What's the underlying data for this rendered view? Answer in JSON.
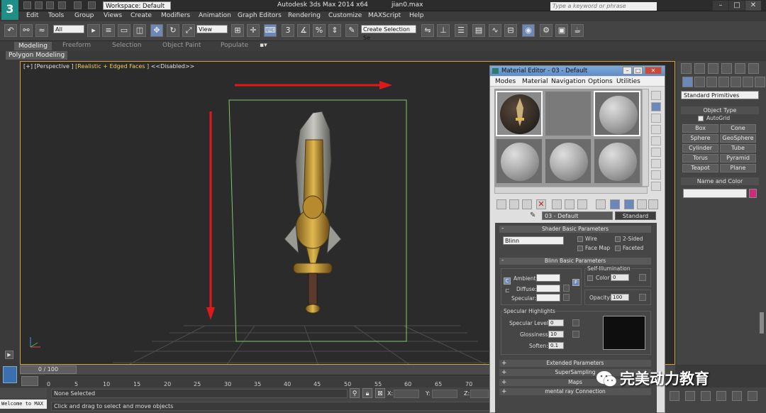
{
  "app": {
    "workspace_label": "Workspace: Default",
    "title": "Autodesk 3ds Max  2014 x64",
    "filename": "jian0.max",
    "search_placeholder": "Type a keyword or phrase"
  },
  "menu": [
    "Edit",
    "Tools",
    "Group",
    "Views",
    "Create",
    "Modifiers",
    "Animation",
    "Graph Editors",
    "Rendering",
    "Customize",
    "MAXScript",
    "Help"
  ],
  "toolbar": {
    "filter_select": "All",
    "ref_coord_select": "View",
    "selection_set_placeholder": "Create Selection Se",
    "icon_names": [
      "undo-icon",
      "redo-icon",
      "link-icon",
      "unlink-icon",
      "bind-space-warp-icon",
      "select-icon",
      "select-by-name-icon",
      "rect-region-icon",
      "window-crossing-icon",
      "move-icon",
      "rotate-icon",
      "scale-icon",
      "pivot-icon",
      "snap-3-icon",
      "angle-snap-icon",
      "percent-snap-icon",
      "spinner-snap-icon",
      "edit-named-sets-icon",
      "mirror-icon",
      "align-icon",
      "layer-icon",
      "graphite-icon",
      "curve-editor-icon",
      "schematic-icon",
      "material-editor-icon",
      "render-setup-icon",
      "render-frame-icon",
      "render-icon"
    ]
  },
  "ribbon": {
    "tabs": [
      "Modeling",
      "Freeform",
      "Selection",
      "Object Paint",
      "Populate"
    ],
    "active_tab": "Modeling",
    "sub_label": "Polygon Modeling"
  },
  "viewport": {
    "label_part1": "[+] [Perspective ]",
    "label_part2": "[Realistic + Edged Faces ]",
    "label_part3": "<<Disabled>>",
    "arrow_color": "#e01818",
    "plane_outline_color": "#7ec96b"
  },
  "command_panel": {
    "primitive_type": "Standard Primitives",
    "object_type_title": "Object Type",
    "autogrid_label": "AutoGrid",
    "objects": [
      "Box",
      "Cone",
      "Sphere",
      "GeoSphere",
      "Cylinder",
      "Tube",
      "Torus",
      "Pyramid",
      "Teapot",
      "Plane"
    ],
    "name_color_title": "Name and Color",
    "object_color": "#d02a7a"
  },
  "material_editor": {
    "title": "Material Editor - 03 - Default",
    "menu": [
      "Modes",
      "Material",
      "Navigation",
      "Options",
      "Utilities"
    ],
    "material_name": "03 - Default",
    "material_type": "Standard",
    "shader_title": "Shader Basic Parameters",
    "shader": "Blinn",
    "shader_options": [
      "Wire",
      "2-Sided",
      "Face Map",
      "Faceted"
    ],
    "blinn_title": "Blinn Basic Parameters",
    "self_illum_title": "Self-Illumination",
    "self_illum_color_label": "Color",
    "self_illum_value": "0",
    "ambient_label": "Ambient:",
    "diffuse_label": "Diffuse:",
    "specular_label": "Specular:",
    "opacity_label": "Opacity:",
    "opacity_value": "100",
    "spec_highlights_title": "Specular Highlights",
    "specular_level_label": "Specular Level:",
    "specular_level_value": "0",
    "glossiness_label": "Glossiness:",
    "glossiness_value": "10",
    "soften_label": "Soften:",
    "soften_value": "0.1",
    "collapsed_rollouts": [
      "Extended Parameters",
      "SuperSampling",
      "Maps",
      "mental ray Connection"
    ],
    "map_letters": {
      "ambient_lock": "C",
      "diffuse_lock": "",
      "specular_link": "F"
    }
  },
  "timeline": {
    "frame_readout": "0 / 100",
    "ticks": [
      "0",
      "5",
      "10",
      "15",
      "20",
      "25",
      "30",
      "35",
      "40",
      "45",
      "50",
      "55",
      "60",
      "65",
      "70"
    ]
  },
  "status": {
    "welcome": "Welcome to MAX",
    "selection": "None Selected",
    "prompt": "Click and drag to select and move objects",
    "x_label": "X:",
    "y_label": "Y:",
    "z_label": "Z:"
  },
  "watermark": {
    "text": "完美动力教育"
  }
}
